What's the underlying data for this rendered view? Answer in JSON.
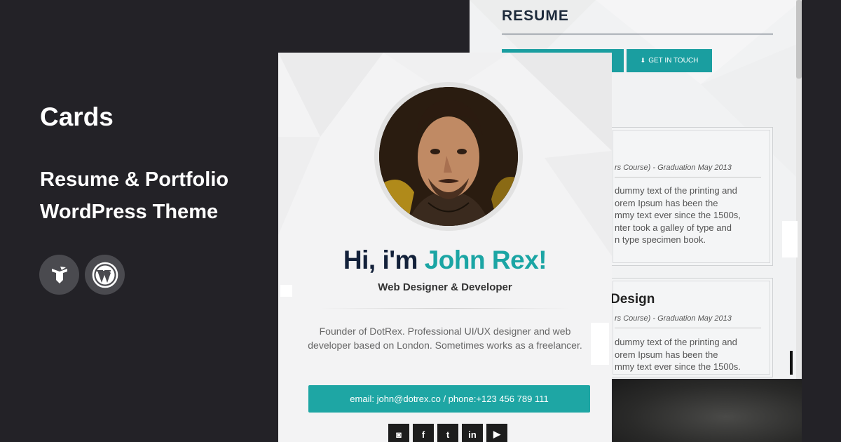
{
  "promo": {
    "title": "Cards",
    "subtitle_line1": "Resume & Portfolio",
    "subtitle_line2": "WordPress Theme",
    "badges": [
      "themeforest-icon",
      "wordpress-icon"
    ]
  },
  "resume_card": {
    "title": "RESUME",
    "buttons": [
      {
        "label": ""
      },
      {
        "label": "GET IN TOUCH",
        "icon": "download-icon"
      }
    ],
    "entries": [
      {
        "heading": "",
        "meta": "rs Course) - Graduation May 2013",
        "text": [
          "dummy text of the printing and",
          "orem Ipsum has been the",
          "mmy text ever since the 1500s,",
          "nter took a galley of type and",
          "n type specimen book."
        ]
      },
      {
        "heading": "Design",
        "meta": "rs Course) - Graduation May 2013",
        "text": [
          "dummy text of the printing and",
          "orem Ipsum has been the",
          "mmy text ever since the 1500s."
        ]
      }
    ]
  },
  "profile_card": {
    "greeting": "Hi, i'm ",
    "name": "John Rex!",
    "role": "Web Designer & Developer",
    "bio": "Founder of DotRex. Professional UI/UX designer and web developer based on London. Sometimes works as a freelancer.",
    "contact": "email: john@dotrex.co / phone:+123 456 789 111",
    "social": [
      {
        "icon": "instagram-icon",
        "glyph": "◙"
      },
      {
        "icon": "facebook-icon",
        "glyph": "f"
      },
      {
        "icon": "twitter-icon",
        "glyph": "t"
      },
      {
        "icon": "linkedin-icon",
        "glyph": "in"
      },
      {
        "icon": "youtube-icon",
        "glyph": "▶"
      }
    ]
  },
  "colors": {
    "background": "#232227",
    "accent": "#1ba5a4",
    "heading_dark": "#13213a"
  }
}
